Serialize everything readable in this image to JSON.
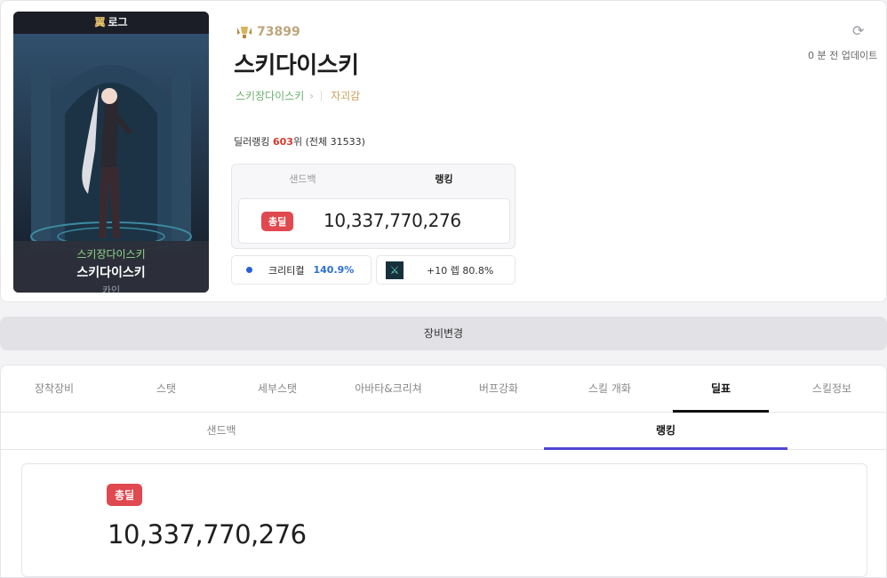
{
  "character": {
    "header": "로그",
    "header_icon": "wing-icon",
    "guild": "스키장다이스키",
    "name": "스키다이스키",
    "server": "카인"
  },
  "fame": {
    "icon": "fame-trophy-icon",
    "value": "73899"
  },
  "title": "스키다이스키",
  "guild_link": "스키장다이스키",
  "adventure": "자괴감",
  "dealer_rank": {
    "prefix": "딜러랭킹 ",
    "rank": "603",
    "suffix": "위 (전체 31533)"
  },
  "rank_box": {
    "tabs": [
      "샌드백",
      "랭킹"
    ],
    "active_tab": "랭킹",
    "badge": "총딜",
    "value": "10,337,770,276"
  },
  "critical": {
    "label": "크리티컬",
    "value": "140.9%"
  },
  "weapon": {
    "icon": "weapon-icon",
    "text": "+10 렙 80.8%"
  },
  "refresh": {
    "icon": "refresh-icon"
  },
  "updated": "0 분 전 업데이트",
  "equip_change": "장비변경",
  "main_tabs": [
    "장착장비",
    "스탯",
    "세부스탯",
    "아바타&크리쳐",
    "버프강화",
    "스킬 개화",
    "딜표",
    "스킬정보"
  ],
  "active_main_tab": "딜표",
  "sub_tabs": [
    "샌드백",
    "랭킹"
  ],
  "active_sub_tab": "랭킹",
  "result": {
    "badge": "총딜",
    "value": "10,337,770,276"
  },
  "colors": {
    "badge": "#e0494f",
    "accent": "#5046d4",
    "crit": "#2d6fd6",
    "fame": "#bfa57b",
    "guild": "#6bb06d"
  }
}
